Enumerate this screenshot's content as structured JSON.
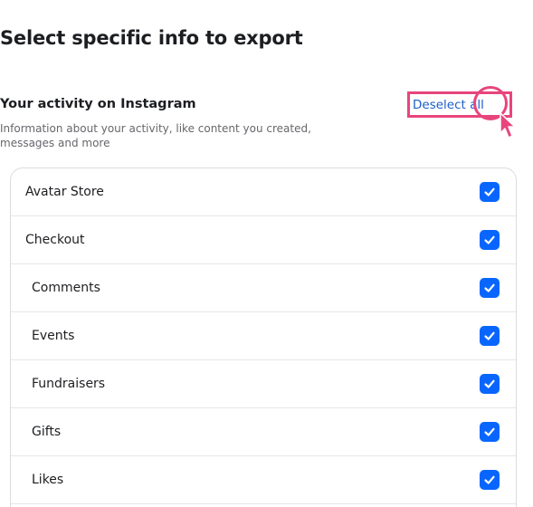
{
  "page": {
    "title": "Select specific info to export"
  },
  "section": {
    "title": "Your activity on Instagram",
    "description": "Information about your activity, like content you created, messages and more",
    "deselect_label": "Deselect all"
  },
  "items": [
    {
      "label": "Avatar Store",
      "checked": true
    },
    {
      "label": "Checkout",
      "checked": true
    },
    {
      "label": "Comments",
      "checked": true
    },
    {
      "label": "Events",
      "checked": true
    },
    {
      "label": "Fundraisers",
      "checked": true
    },
    {
      "label": "Gifts",
      "checked": true
    },
    {
      "label": "Likes",
      "checked": true
    }
  ],
  "colors": {
    "checkbox": "#0866ff",
    "highlight": "#e8457c",
    "link": "#1d5ec7"
  }
}
